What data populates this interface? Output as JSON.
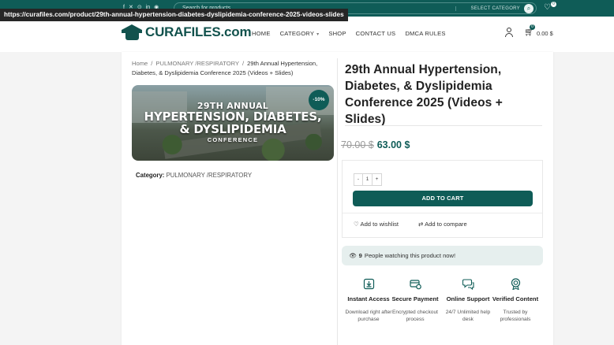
{
  "url_tooltip": "https://curafiles.com/product/29th-annual-hypertension-diabetes-dyslipidemia-conference-2025-videos-slides",
  "topbar": {
    "social_icons": [
      "facebook-icon",
      "x-icon",
      "pinterest-icon",
      "linkedin-icon",
      "telegram-icon"
    ],
    "search_placeholder": "Search for products",
    "category_select": "SELECT CATEGORY",
    "wishlist_count": "0",
    "brand_color": "#0f5c57"
  },
  "header": {
    "logo_text": "CURAFILES.com",
    "nav": [
      "HOME",
      "CATEGORY",
      "SHOP",
      "CONTACT US",
      "DMCA RULES"
    ],
    "cart_count": "0",
    "cart_total": "0.00 $"
  },
  "breadcrumb": {
    "home": "Home",
    "category": "PULMONARY /RESPIRATORY",
    "current": "29th Annual Hypertension, Diabetes, & Dyslipidemia Conference 2025 (Videos + Slides)"
  },
  "image": {
    "line1": "29TH ANNUAL",
    "line2": "HYPERTENSION, DIABETES,",
    "line3": "& DYSLIPIDEMIA",
    "line4": "CONFERENCE",
    "badge": "-10%"
  },
  "category_line": {
    "label": "Category:",
    "value": "PULMONARY /RESPIRATORY"
  },
  "product": {
    "title": "29th Annual Hypertension, Diabetes, & Dyslipidemia Conference 2025 (Videos + Slides)",
    "old_price": "70.00 $",
    "new_price": "63.00 $",
    "qty_minus": "-",
    "qty_value": "1",
    "qty_plus": "+",
    "add_to_cart": "ADD TO CART",
    "wishlist": "Add to wishlist",
    "compare": "Add to compare",
    "watchers_count": "9",
    "watchers_text": "People watching this product now!"
  },
  "features": [
    {
      "icon": "download-icon",
      "title": "Instant Access",
      "desc": "Download right after purchase"
    },
    {
      "icon": "secure-card-icon",
      "title": "Secure Payment",
      "desc": "Encrypted checkout process"
    },
    {
      "icon": "support-chat-icon",
      "title": "Online Support",
      "desc": "24/7 Unlimited help desk"
    },
    {
      "icon": "verified-badge-icon",
      "title": "Verified Content",
      "desc": "Trusted by professionals"
    }
  ]
}
